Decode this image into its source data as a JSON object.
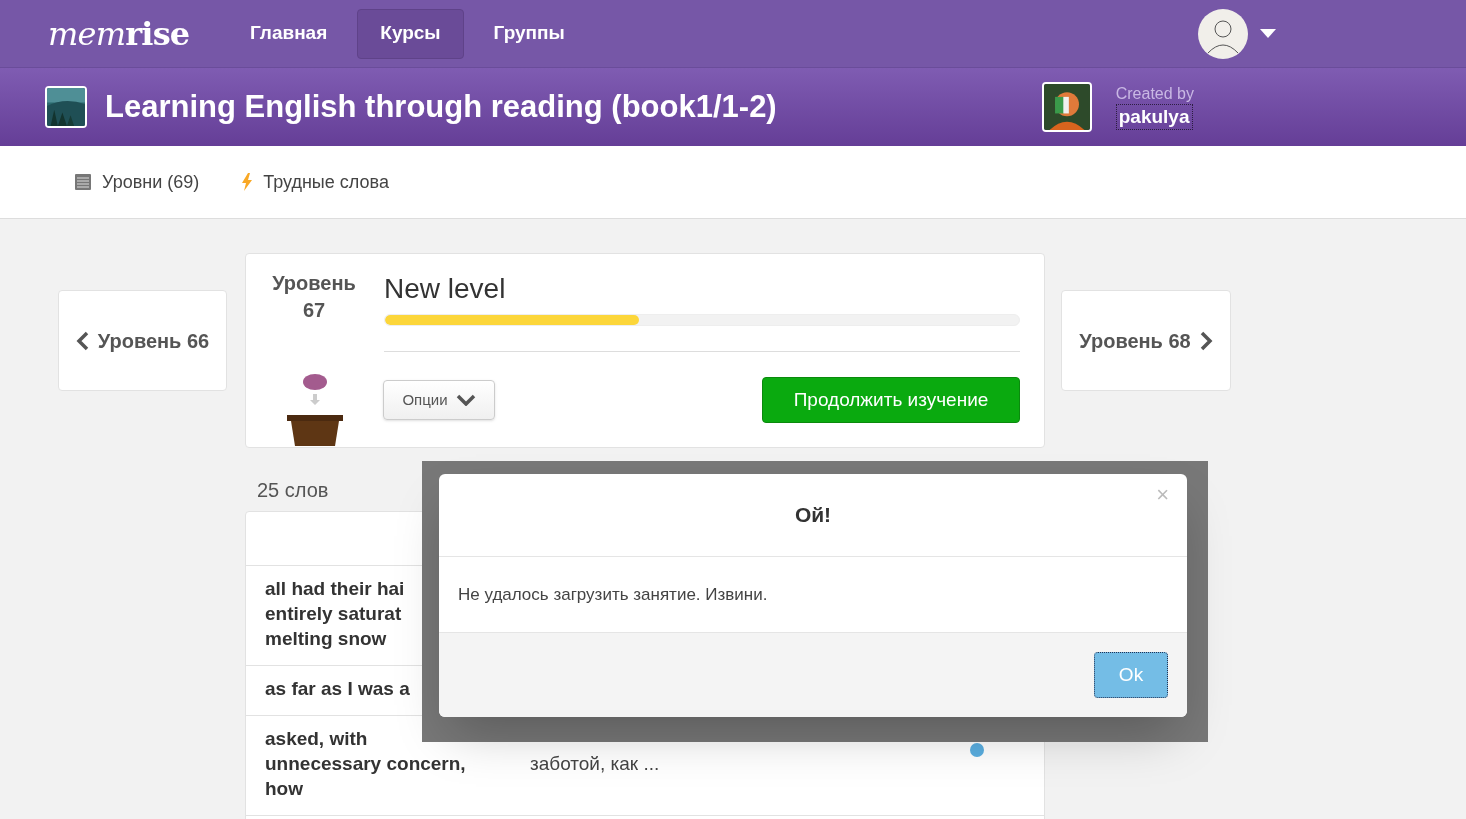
{
  "header": {
    "logo": {
      "light": "mem",
      "bold": "rise"
    },
    "nav": [
      {
        "label": "Главная",
        "selected": false
      },
      {
        "label": "Курсы",
        "selected": true
      },
      {
        "label": "Группы",
        "selected": false
      }
    ]
  },
  "course": {
    "title": "Learning English through reading (book1/1-2)",
    "created_by": "Created by",
    "author": "pakulya"
  },
  "subnav": [
    {
      "label": "Уровни (69)",
      "kind": "levels"
    },
    {
      "label": "Трудные слова",
      "kind": "difficult"
    }
  ],
  "prev_level": "Уровень 66",
  "next_level": "Уровень 68",
  "level": {
    "label": "Уровень",
    "number": "67",
    "title": "New level",
    "level": 0.4,
    "options": "Опции",
    "continue": "Продолжить изучение"
  },
  "word_count": "25 слов",
  "words": [
    {
      "kind": "plain",
      "word": [
        "all had their hai",
        "entirely saturat",
        "melting snow"
      ]
    },
    {
      "kind": "plain",
      "word": [
        "as far as I was a"
      ]
    },
    {
      "kind": "learning",
      "word": [
        "asked, with",
        "unnecessary concern,",
        "how"
      ],
      "translation": [
        "заботой, как ..."
      ]
    }
  ],
  "dialog": {
    "title": "Ой!",
    "message": "Не удалось загрузить занятие. Извини.",
    "close": "×",
    "ok": "Ok"
  }
}
